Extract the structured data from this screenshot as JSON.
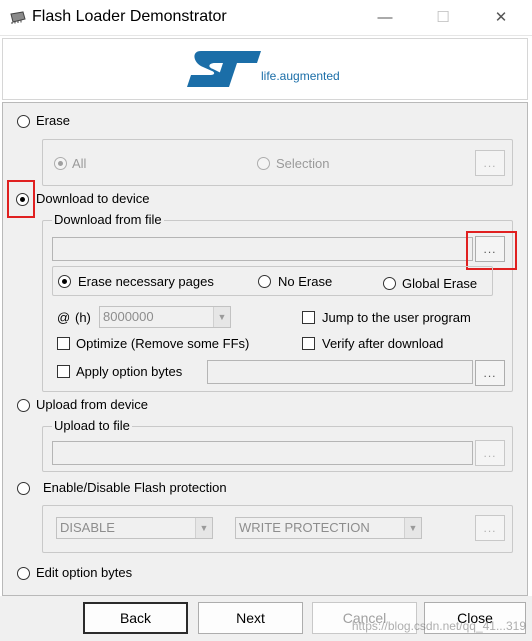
{
  "window": {
    "title": "Flash Loader Demonstrator",
    "minimize_glyph": "—",
    "maximize_glyph": "☐",
    "close_glyph": "✕"
  },
  "logo": {
    "text": "ST",
    "tagline": "life.augmented",
    "color": "#1b6ea8"
  },
  "erase": {
    "label": "Erase",
    "options": {
      "all": "All",
      "selection": "Selection"
    },
    "browse_label": "..."
  },
  "download": {
    "label": "Download to device",
    "from_file_label": "Download from file",
    "file_value": "",
    "browse_label": "...",
    "erase_modes": {
      "necessary": "Erase necessary pages",
      "no_erase": "No Erase",
      "global": "Global Erase"
    },
    "address_at": "@",
    "address_hex": "(h)",
    "address_value": "8000000",
    "jump_label": "Jump to the user program",
    "optimize_label": "Optimize (Remove some FFs)",
    "verify_label": "Verify after download",
    "apply_option_bytes_label": "Apply option bytes",
    "option_file_value": "",
    "option_browse_label": "..."
  },
  "upload": {
    "label": "Upload from device",
    "to_file_label": "Upload to file",
    "file_value": "",
    "browse_label": "..."
  },
  "protection": {
    "label": "Enable/Disable Flash protection",
    "mode_value": "DISABLE",
    "type_value": "WRITE PROTECTION",
    "browse_label": "..."
  },
  "option_bytes": {
    "label": "Edit option bytes"
  },
  "buttons": {
    "back": "Back",
    "next": "Next",
    "cancel": "Cancel",
    "close": "Close"
  },
  "watermark": "https://blog.csdn.net/qq_41...319",
  "colors": {
    "highlight": "#e02020",
    "panel": "#f0f0f0"
  }
}
